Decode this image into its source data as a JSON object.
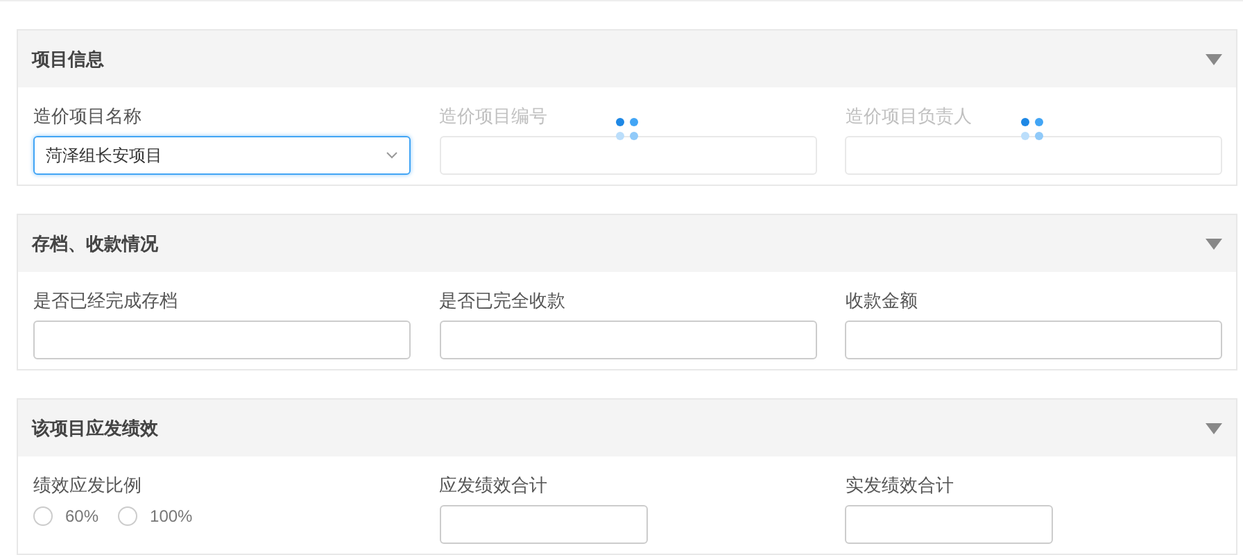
{
  "sections": [
    {
      "title": "项目信息",
      "fields": [
        {
          "kind": "select",
          "label": "造价项目名称",
          "value": "菏泽组长安项目",
          "disabled": false,
          "focused": true,
          "loading": false
        },
        {
          "kind": "input",
          "label": "造价项目编号",
          "disabled": true,
          "focused": false,
          "loading": true
        },
        {
          "kind": "input",
          "label": "造价项目负责人",
          "disabled": true,
          "focused": false,
          "loading": true
        }
      ]
    },
    {
      "title": "存档、收款情况",
      "fields": [
        {
          "kind": "input",
          "label": "是否已经完成存档",
          "disabled": false,
          "focused": false,
          "loading": false
        },
        {
          "kind": "input",
          "label": "是否已完全收款",
          "disabled": false,
          "focused": false,
          "loading": false
        },
        {
          "kind": "input",
          "label": "收款金额",
          "disabled": false,
          "focused": false,
          "loading": false
        }
      ]
    },
    {
      "title": "该项目应发绩效",
      "fields": [
        {
          "kind": "radio",
          "label": "绩效应发比例",
          "options": [
            {
              "label": "60%",
              "selected": false
            },
            {
              "label": "100%",
              "selected": false
            }
          ]
        },
        {
          "kind": "short_input",
          "label": "应发绩效合计",
          "disabled": false,
          "focused": false,
          "loading": false
        },
        {
          "kind": "short_input",
          "label": "实发绩效合计",
          "disabled": false,
          "focused": false,
          "loading": false
        }
      ]
    }
  ]
}
